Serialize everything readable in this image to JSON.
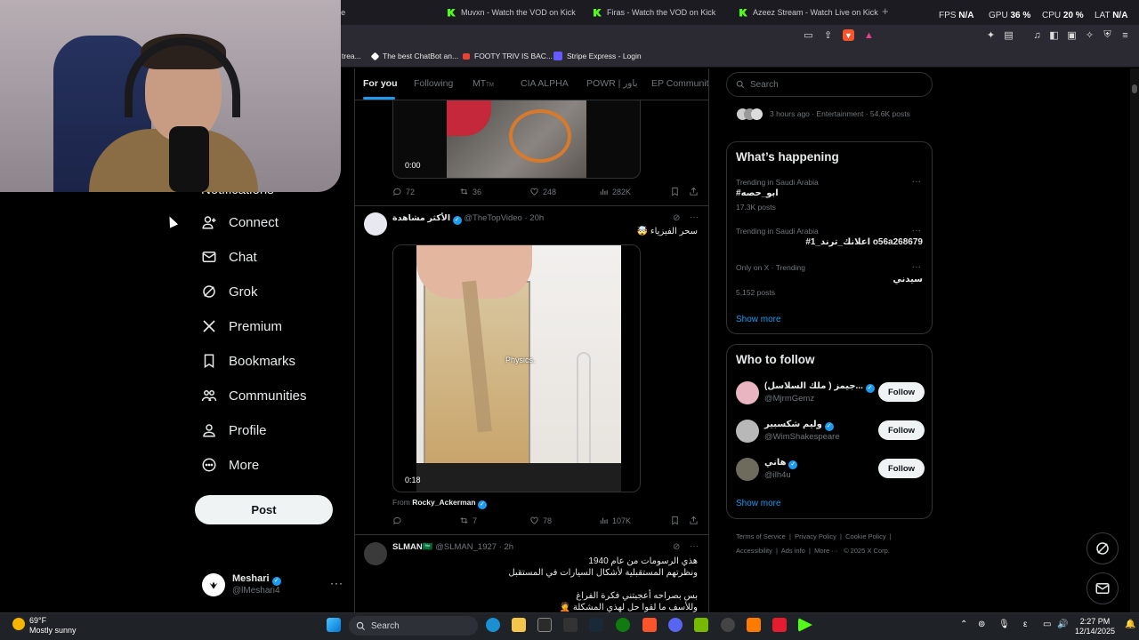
{
  "browser": {
    "tabs": [
      {
        "label": "Tube"
      },
      {
        "label": "Muvxn - Watch the VOD on Kick"
      },
      {
        "label": "Firas - Watch the VOD on Kick"
      },
      {
        "label": "Azeez Stream - Watch Live on Kick"
      }
    ],
    "new_tab": "+",
    "perf": {
      "fps_label": "FPS",
      "fps": "N/A",
      "gpu_label": "GPU",
      "gpu": "36 %",
      "cpu_label": "CPU",
      "cpu": "20 %",
      "lat_label": "LAT",
      "lat": "N/A"
    },
    "bookmarks": [
      {
        "label": "trea..."
      },
      {
        "label": "The best ChatBot an..."
      },
      {
        "label": "FOOTY TRIV IS BAC..."
      },
      {
        "label": "Stripe Express - Login"
      }
    ]
  },
  "nav": {
    "partial_item": "Notifications",
    "items": [
      {
        "label": "Connect"
      },
      {
        "label": "Chat"
      },
      {
        "label": "Grok"
      },
      {
        "label": "Premium"
      },
      {
        "label": "Bookmarks"
      },
      {
        "label": "Communities"
      },
      {
        "label": "Profile"
      },
      {
        "label": "More"
      }
    ],
    "post_button": "Post",
    "account": {
      "name": "Meshari",
      "handle": "@lMeshari4"
    }
  },
  "feed": {
    "tabs": [
      "For you",
      "Following",
      "MT",
      "CIA ALPHA",
      "POWR | باور",
      "EP Communit"
    ],
    "mt_suffix": "TM",
    "post1": {
      "video_time": "0:00",
      "stats": {
        "replies": "72",
        "reposts": "36",
        "likes": "248",
        "views": "282K"
      }
    },
    "post2": {
      "name": "الأكثر مشاهدة",
      "handle": "@TheTopVideo",
      "time": "20h",
      "text": "سحر الفيزياء 🤯",
      "video_caption": "Physics.",
      "video_time": "0:18",
      "from_label": "From",
      "from_user": "Rocky_Ackerman",
      "stats": {
        "replies": "",
        "reposts": "7",
        "likes": "78",
        "views": "107K"
      }
    },
    "post3": {
      "name": "SLMAN🇸🇦",
      "handle": "@SLMAN_1927",
      "time": "2h",
      "text_line1": "هذي الرسومات من عام 1940",
      "text_line2": "ونظرتهم المستقبلية لأشكال السيارات في المستقبل",
      "text_line3": "بس بصراحه أعجبتني فكرة الفراغ",
      "text_line4": "وللأسف ما لقوا حل لهذي المشكلة 🤦"
    }
  },
  "sidebar": {
    "search_placeholder": "Search",
    "top_meta": "3 hours ago · Entertainment · 54.6K posts",
    "happening_title": "What’s happening",
    "trends": [
      {
        "meta": "Trending in Saudi Arabia",
        "name": "#ابو_حصه",
        "posts": "17.3K posts"
      },
      {
        "meta": "Trending in Saudi Arabia",
        "name": "#اعلانك_ترند_1 o56a268679",
        "posts": ""
      },
      {
        "meta": "Only on X · Trending",
        "name": "سيدني",
        "posts": "5,152 posts"
      }
    ],
    "show_more": "Show more",
    "who_title": "Who to follow",
    "who": [
      {
        "name": "(ملك السلاسل ) جيمز...",
        "handle": "@MjrmGemz",
        "button": "Follow"
      },
      {
        "name": "وليم شكسبير",
        "handle": "@WimShakespeare",
        "button": "Follow"
      },
      {
        "name": "هاني",
        "handle": "@ilh4u",
        "button": "Follow"
      }
    ],
    "footer_line1": [
      "Terms of Service",
      "Privacy Policy",
      "Cookie Policy"
    ],
    "footer_line2": [
      "Accessibility",
      "Ads info",
      "More ···",
      "© 2025 X Corp."
    ]
  },
  "taskbar": {
    "weather_temp": "69°F",
    "weather_desc": "Mostly sunny",
    "search_label": "Search",
    "time": "2:27 PM",
    "date": "12/14/2025",
    "lang": "ε"
  },
  "colors": {
    "accent": "#1d9bf0",
    "kick": "#53fc18",
    "bg": "#000000"
  }
}
